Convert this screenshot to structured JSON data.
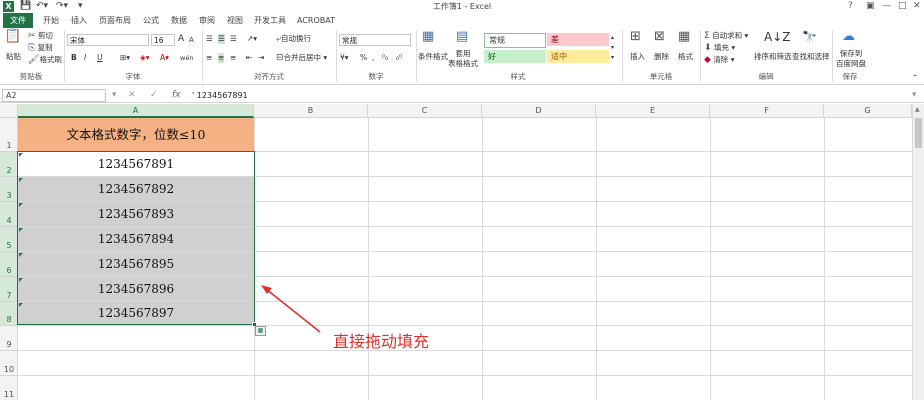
{
  "title_bar": {
    "title": "工作簿1 - Excel",
    "logo": "X",
    "qat": [
      "save-icon",
      "undo-icon",
      "redo-icon",
      "customize-icon"
    ],
    "buttons": [
      "?",
      "▣",
      "—",
      "□",
      "✕"
    ]
  },
  "tabs": [
    {
      "label": "文件",
      "active": true
    },
    {
      "label": "开始",
      "active": false
    },
    {
      "label": "插入",
      "active": false
    },
    {
      "label": "页面布局",
      "active": false
    },
    {
      "label": "公式",
      "active": false
    },
    {
      "label": "数据",
      "active": false
    },
    {
      "label": "审阅",
      "active": false
    },
    {
      "label": "视图",
      "active": false
    },
    {
      "label": "开发工具",
      "active": false
    },
    {
      "label": "ACROBAT",
      "active": false
    }
  ],
  "ribbon": {
    "clipboard": {
      "paste": "粘贴",
      "cut": "剪切",
      "copy": "复制",
      "format_painter": "格式刷",
      "group": "剪贴板"
    },
    "font": {
      "name": "宋体",
      "size": "16",
      "bold": "B",
      "italic": "I",
      "underline": "U",
      "grow": "A",
      "shrink": "A",
      "wen": "wén",
      "group": "字体"
    },
    "alignment": {
      "wrap": "自动换行",
      "merge": "合并后居中",
      "group": "对齐方式"
    },
    "number": {
      "format": "常规",
      "percent": "%",
      "comma": ",",
      "group": "数字"
    },
    "styles": {
      "conditional": "条件格式",
      "table": "套用\n表格格式",
      "normal": "常规",
      "bad": "差",
      "good": "好",
      "neutral": "适中",
      "group": "样式"
    },
    "cells": {
      "insert": "插入",
      "delete": "删除",
      "format": "格式",
      "group": "单元格"
    },
    "editing": {
      "autosum": "自动求和",
      "fill": "填充",
      "clear": "清除",
      "sort": "排序和筛选",
      "find": "查找和选择",
      "group": "编辑"
    },
    "save": {
      "label": "保存到\n百度网盘",
      "group": "保存"
    },
    "colors": {
      "accent": "#217346",
      "normal": "#ffffff",
      "bad": "#ffc7ce",
      "good": "#c6efce",
      "neutral": "#ffeb9c"
    }
  },
  "formula_bar": {
    "name_box": "A2",
    "fx": "fx",
    "content": "' 1234567891"
  },
  "columns": [
    "A",
    "B",
    "C",
    "D",
    "E",
    "F",
    "G"
  ],
  "rows": [
    "1",
    "2",
    "3",
    "4",
    "5",
    "6",
    "7",
    "8",
    "9",
    "10",
    "11"
  ],
  "cells": {
    "header": "文本格式数字，位数≤10",
    "values": [
      "1234567891",
      "1234567892",
      "1234567893",
      "1234567894",
      "1234567895",
      "1234567896",
      "1234567897"
    ]
  },
  "annotation": "直接拖动填充",
  "annotation_color": "#e0302c"
}
